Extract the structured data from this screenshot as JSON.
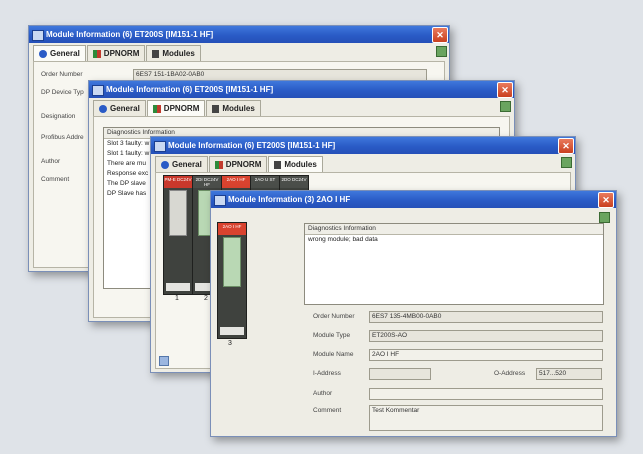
{
  "windows": {
    "back": {
      "title": "Module Information  (6) ET200S [IM151-1 HF]",
      "tabs": [
        "General",
        "DPNORM",
        "Modules"
      ],
      "labels": [
        "Order Number",
        "DP Device Typ",
        "Designation",
        "Profibus Addre",
        "Author",
        "Comment"
      ],
      "order_number": "6ES7 151-1BA02-0AB0"
    },
    "second": {
      "title": "Module Information  (6) ET200S [IM151-1 HF]",
      "tabs": [
        "General",
        "DPNORM",
        "Modules"
      ],
      "diag_header": "Diagnostics Information",
      "diag_lines": [
        "Slot 3 faulty: w",
        "Slot 1 faulty: w",
        "There are mu",
        "Response exc",
        "The DP slave",
        "DP Slave has"
      ]
    },
    "third": {
      "title": "Module Information  (6) ET200S [IM151-1 HF]",
      "tabs": [
        "General",
        "DPNORM",
        "Modules"
      ],
      "modules": [
        "PM-E DC24V",
        "2DI DC24V HF",
        "2AO I HF",
        "2AO U ST",
        "2DO DC24V"
      ],
      "slot_numbers": [
        "1",
        "2"
      ]
    },
    "front": {
      "title": "Module Information  (3) 2AO I HF",
      "module_head": "2AO I HF",
      "slot_number": "3",
      "diag_header": "Diagnostics Information",
      "diag_text": "wrong module; bad data",
      "labels": {
        "order_number": "Order Number",
        "module_type": "Module Type",
        "module_name": "Module Name",
        "i_address": "I-Address",
        "o_address": "O-Address",
        "author": "Author",
        "comment": "Comment"
      },
      "values": {
        "order_number": "6ES7 135-4MB00-0AB0",
        "module_type": "ET200S-AO",
        "module_name": "2AO I HF",
        "i_address": "",
        "o_address": "517...520",
        "author": "",
        "comment": "Test Kommentar"
      }
    }
  },
  "colors": {
    "titlebar": "#2a5bc6",
    "close_button": "#c9401f",
    "module_red": "#d9432f",
    "module_green": "#b9d8b4"
  }
}
